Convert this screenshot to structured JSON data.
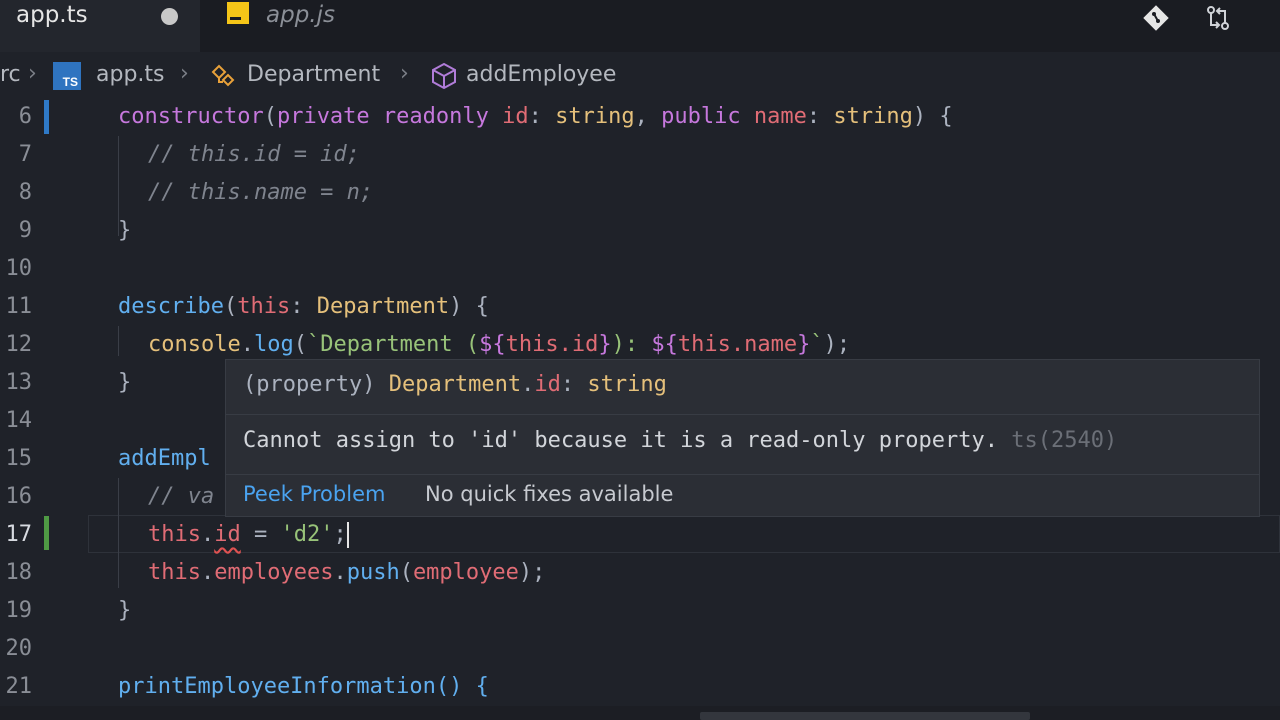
{
  "tabs": {
    "active": {
      "label": "app.ts",
      "dirty": true
    },
    "inactive": {
      "label": "app.js",
      "icon": "js-file-icon"
    }
  },
  "toolbar_icons": [
    "git-icon",
    "compare-changes-icon"
  ],
  "breadcrumb": {
    "root": "rc",
    "file": "app.ts",
    "class": "Department",
    "method": "addEmployee"
  },
  "lines": [
    {
      "n": "6"
    },
    {
      "n": "7"
    },
    {
      "n": "8"
    },
    {
      "n": "9"
    },
    {
      "n": "10"
    },
    {
      "n": "11"
    },
    {
      "n": "12"
    },
    {
      "n": "13"
    },
    {
      "n": "14"
    },
    {
      "n": "15"
    },
    {
      "n": "16"
    },
    {
      "n": "17"
    },
    {
      "n": "18"
    },
    {
      "n": "19"
    },
    {
      "n": "20"
    },
    {
      "n": "21"
    }
  ],
  "code": {
    "l6": {
      "kw": "constructor",
      "p1": "(",
      "mod1": "private",
      "mod2": "readonly",
      "id": "id",
      "colon": ":",
      "t1": "string",
      "comma": ",",
      "mod3": "public",
      "name": "name",
      "colon2": ":",
      "t2": "string",
      "tail": ") {"
    },
    "l7": "// this.id = id;",
    "l8": "// this.name = n;",
    "l9": "}",
    "l11": {
      "fn": "describe",
      "p1": "(",
      "kw": "this",
      "colon": ": ",
      "type": "Department",
      "tail": ") {"
    },
    "l12": {
      "obj": "console",
      "dot": ".",
      "fn": "log",
      "p1": "(",
      "tpl1": "`Department (",
      "i1": "${",
      "this1": "this",
      "prop1": ".id",
      "i1e": "}",
      "tpl2": "): ",
      "i2": "${",
      "this2": "this",
      "prop2": ".name",
      "i2e": "}",
      "tpl3": "`",
      "tail": ");"
    },
    "l13": "}",
    "l15": "addEmpl",
    "l16": "// va",
    "l17": {
      "kw": "this",
      "dot": ".",
      "prop": "id",
      "op": " = ",
      "str": "'d2'",
      "semi": ";"
    },
    "l18": {
      "kw": "this",
      "dot": ".",
      "prop": "employees",
      "dot2": ".",
      "fn": "push",
      "p1": "(",
      "arg": "employee",
      "tail": ");"
    },
    "l19": "}",
    "l21": "printEmployeeInformation() {"
  },
  "hover": {
    "sig_prefix": "(property) ",
    "sig_class": "Department",
    "sig_dot": ".",
    "sig_prop": "id",
    "sig_colon": ": ",
    "sig_type": "string",
    "message": "Cannot assign to 'id' because it is a read-only property.",
    "code": " ts(2540)",
    "peek": "Peek Problem",
    "no_fix": "No quick fixes available"
  },
  "colors": {
    "background": "#1f2229",
    "keyword": "#c678dd",
    "function": "#61afef",
    "string": "#98c379",
    "type": "#e5c07b",
    "property": "#e06c75",
    "error_squiggle": "#e05252",
    "link": "#4aa3f0"
  }
}
